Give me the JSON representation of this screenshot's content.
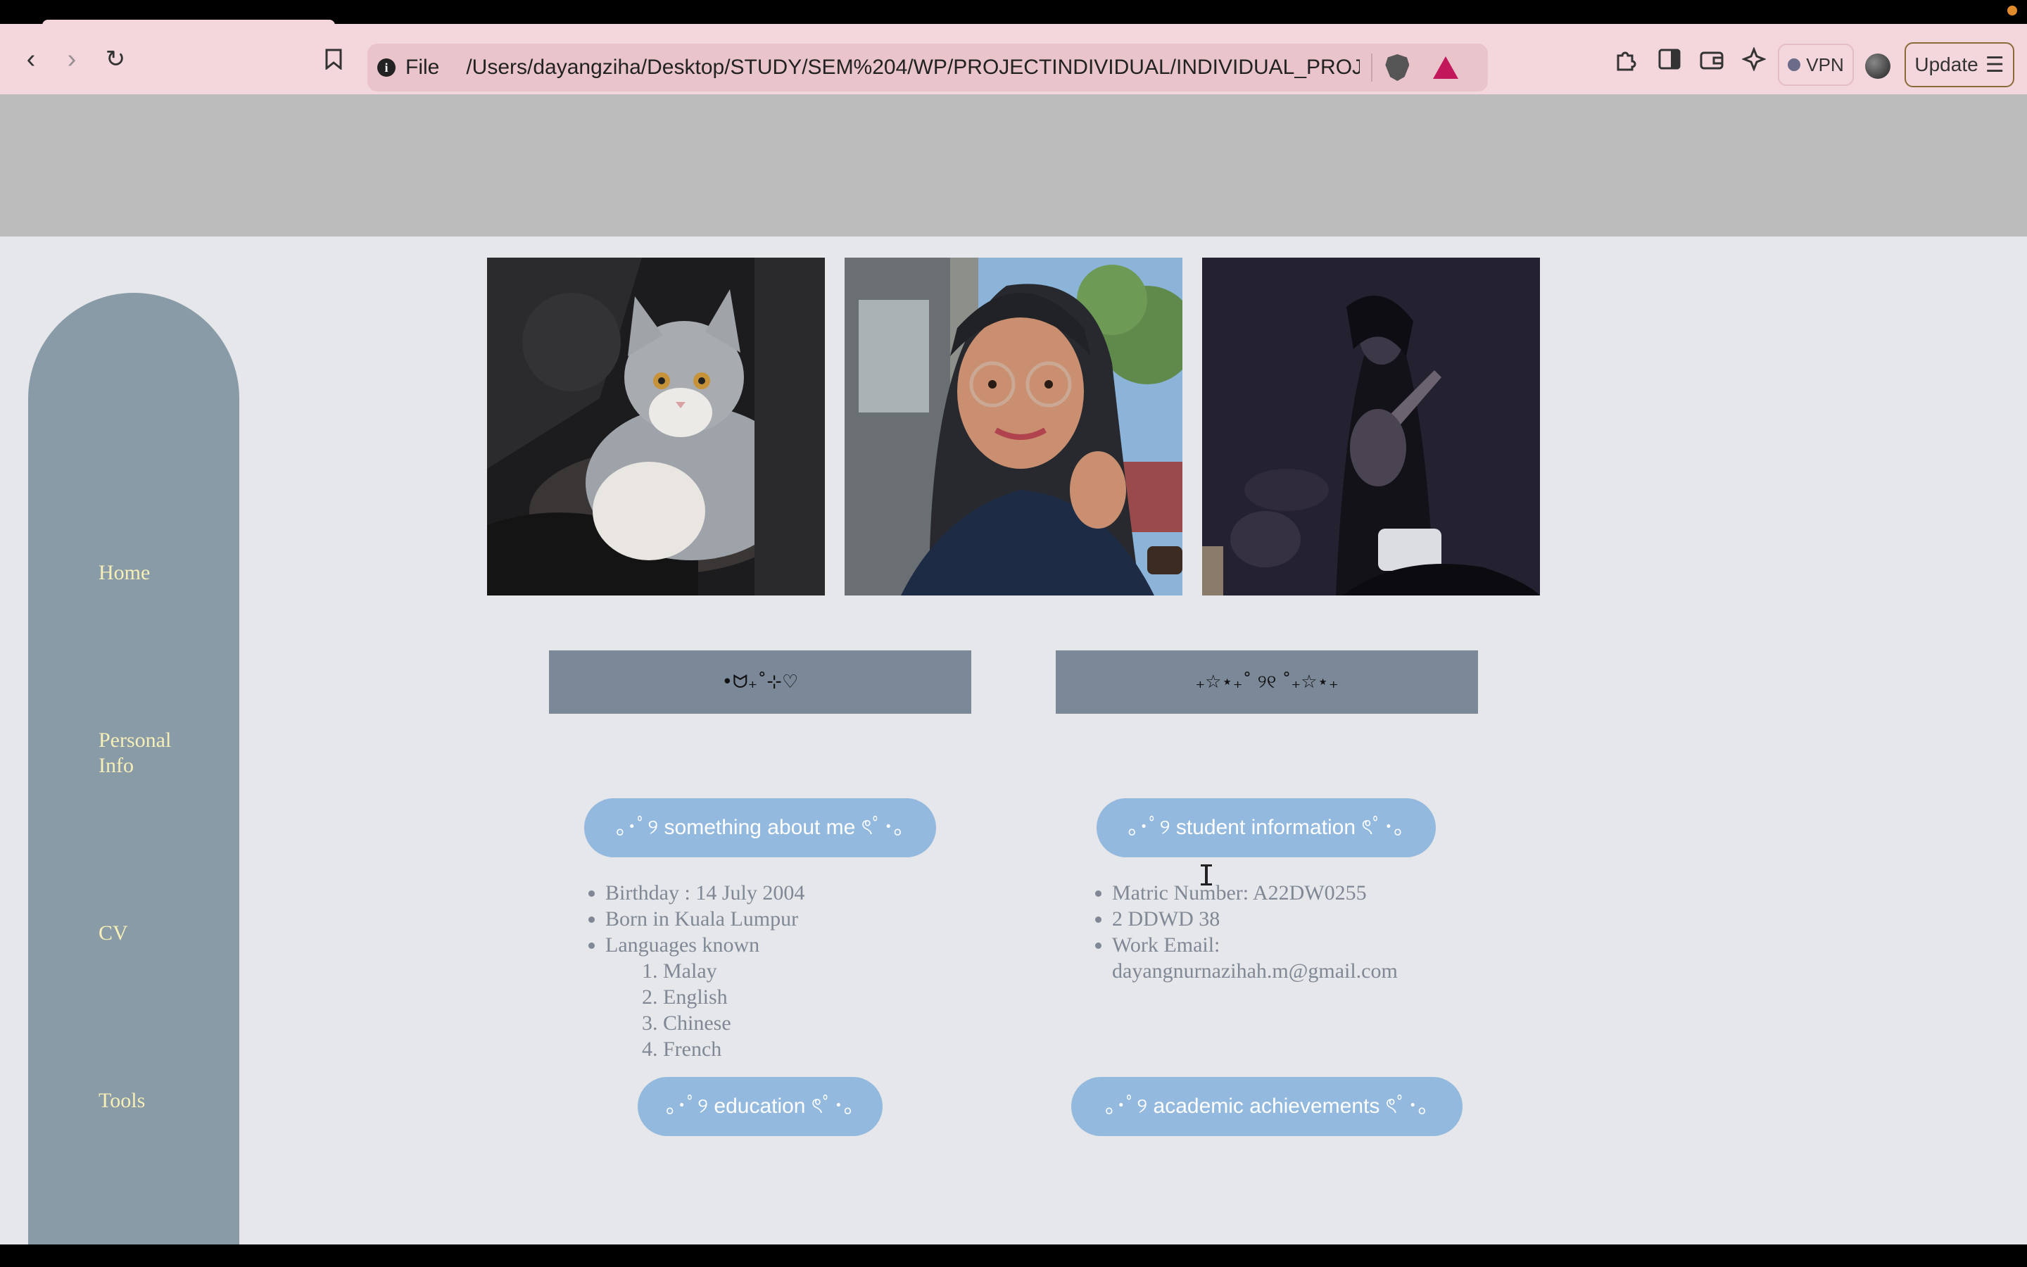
{
  "browser": {
    "file_label": "File",
    "url": "/Users/dayangziha/Desktop/STUDY/SEM%204/WP/PROJECTINDIVIDUAL/INDIVIDUAL_PROJE...",
    "vpn_label": "VPN",
    "update_label": "Update",
    "icons": [
      "back-icon",
      "forward-icon",
      "reload-icon",
      "bookmark-icon",
      "info-icon",
      "brave-shield-icon",
      "brave-rewards-icon",
      "extensions-icon",
      "sidebar-icon",
      "wallet-icon",
      "leo-ai-icon",
      "vpn-icon",
      "profile-icon",
      "menu-icon"
    ]
  },
  "sidebar": {
    "items": [
      {
        "label": "Home"
      },
      {
        "label": "Personal Info"
      },
      {
        "label": "CV"
      },
      {
        "label": "Tools"
      }
    ]
  },
  "photos": [
    {
      "name": "cat-photo"
    },
    {
      "name": "selfie-photo"
    },
    {
      "name": "guitar-stage-photo"
    }
  ],
  "deco_boxes": [
    {
      "text": "•ᗢ₊˚⊹♡"
    },
    {
      "text": "₊☆⋆₊˚ ୨୧ ˚₊☆⋆₊"
    }
  ],
  "sections": {
    "about": {
      "button": "｡･ﾟ୨ something about me ৎﾟ･｡",
      "items": [
        "Birthday : 14 July 2004",
        "Born in Kuala Lumpur",
        "Languages known"
      ],
      "languages": [
        "Malay",
        "English",
        "Chinese",
        "French"
      ]
    },
    "student": {
      "button": "｡･ﾟ୨ student information ৎﾟ･｡",
      "items": [
        "Matric Number: A22DW0255",
        "2 DDWD 38",
        "Work Email:"
      ],
      "email": "dayangnurnazihah.m@gmail.com"
    },
    "education": {
      "button": "｡･ﾟ୨ education ৎﾟ･｡"
    },
    "achievements": {
      "button": "｡･ﾟ୨ academic achievements ৎﾟ･｡"
    }
  },
  "colors": {
    "browser_toolbar": "#f4d7dc",
    "sidebar": "#8a9ba8",
    "sidebar_text": "#f6efb7",
    "pill": "#93b9de",
    "deco_box": "#7a8898",
    "header_band": "#bcbcbd",
    "page_bg": "#e6e7ea"
  }
}
